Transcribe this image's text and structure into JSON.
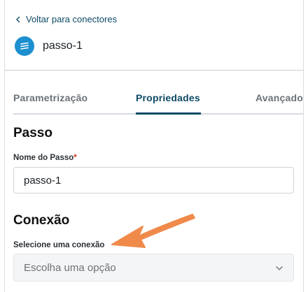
{
  "header": {
    "back_label": "Voltar para conectores",
    "connector_name": "passo-1"
  },
  "tabs": [
    {
      "label": "Parametrização"
    },
    {
      "label": "Propriedades"
    },
    {
      "label": "Avançado"
    }
  ],
  "active_tab": "Propriedades",
  "step_section": {
    "title": "Passo",
    "name_label": "Nome do Passo",
    "required_mark": "*",
    "name_value": "passo-1"
  },
  "connection_section": {
    "title": "Conexão",
    "select_label": "Selecione uma conexão",
    "select_placeholder": "Escolha uma opção"
  },
  "colors": {
    "accent": "#0d4a66",
    "annotation_arrow": "#f08a4b",
    "connector_icon": "#1d8fcf",
    "required": "#d03020"
  },
  "icons": {
    "back": "chevron-left-icon",
    "connector": "connector-stack-icon",
    "select": "chevron-down-icon",
    "annotation": "arrow-annotation"
  }
}
